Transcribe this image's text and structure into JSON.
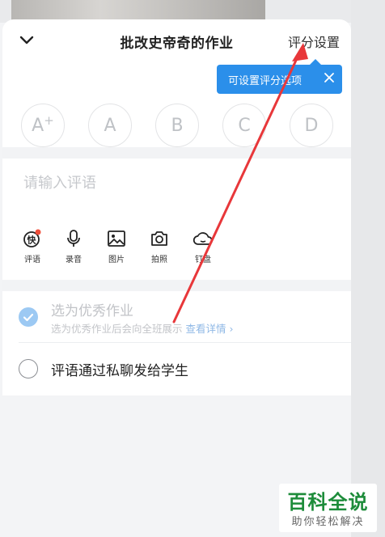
{
  "header": {
    "title": "批改史帝奇的作业",
    "settings_label": "评分设置",
    "back_icon": "chevron-down-icon"
  },
  "tooltip": {
    "text": "可设置评分选项",
    "close_icon": "close-icon",
    "color": "#2b8fea"
  },
  "grades": [
    "A",
    "A",
    "B",
    "C",
    "D"
  ],
  "grade_plus": "+",
  "comment": {
    "placeholder": "请输入评语",
    "value": ""
  },
  "tools": [
    {
      "label": "评语",
      "icon": "quick-comment-icon",
      "glyph": "快",
      "badge": true
    },
    {
      "label": "录音",
      "icon": "microphone-icon"
    },
    {
      "label": "图片",
      "icon": "image-icon"
    },
    {
      "label": "拍照",
      "icon": "camera-icon"
    },
    {
      "label": "钉盘",
      "icon": "cloud-icon"
    }
  ],
  "options": {
    "excellent": {
      "title": "选为优秀作业",
      "subtitle": "选为优秀作业后会向全班展示",
      "link": "查看详情",
      "checked": true
    },
    "private_message": {
      "title": "评语通过私聊发给学生",
      "checked": false
    }
  },
  "watermark": {
    "main": "百科全说",
    "sub": "助你轻松解决",
    "color": "#1d8c3a"
  },
  "annotation": {
    "arrow_color": "#e8373a"
  }
}
